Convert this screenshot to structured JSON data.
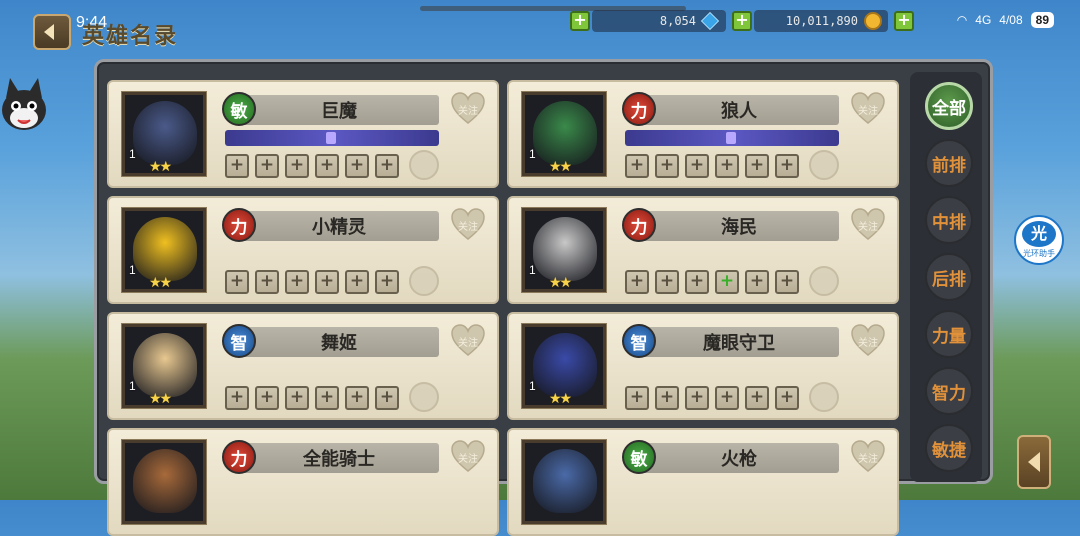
{
  "status_bar": {
    "time": "9:44",
    "signal": "4G",
    "battery": "89",
    "network_speed": "4/08"
  },
  "header": {
    "title": "英雄名录",
    "back_icon": "back-arrow-icon"
  },
  "resources": [
    {
      "name": "diamond",
      "value": "8,054",
      "icon": "gem-icon"
    },
    {
      "name": "gold",
      "value": "10,011,890",
      "icon": "coin-icon"
    }
  ],
  "filters": [
    {
      "label": "全部",
      "active": true
    },
    {
      "label": "前排",
      "active": false
    },
    {
      "label": "中排",
      "active": false
    },
    {
      "label": "后排",
      "active": false
    },
    {
      "label": "力量",
      "active": false
    },
    {
      "label": "智力",
      "active": false
    },
    {
      "label": "敏捷",
      "active": false
    }
  ],
  "heroes": [
    {
      "name": "巨魔",
      "class": "敏",
      "class_type": "agi",
      "level": "1",
      "stars": 2,
      "progress": true,
      "art_color": "#4a5a8a",
      "slots": [
        "+",
        "+",
        "+",
        "+",
        "+",
        "+"
      ],
      "ready_slot": -1,
      "follow": "关注"
    },
    {
      "name": "狼人",
      "class": "力",
      "class_type": "str",
      "level": "1",
      "stars": 2,
      "progress": true,
      "art_color": "#3a8a4a",
      "slots": [
        "+",
        "+",
        "+",
        "+",
        "+",
        "+"
      ],
      "ready_slot": -1,
      "follow": "关注"
    },
    {
      "name": "小精灵",
      "class": "力",
      "class_type": "str",
      "level": "1",
      "stars": 2,
      "progress": false,
      "art_color": "#f0c020",
      "slots": [
        "+",
        "+",
        "+",
        "+",
        "+",
        "+"
      ],
      "ready_slot": -1,
      "follow": "关注"
    },
    {
      "name": "海民",
      "class": "力",
      "class_type": "str",
      "level": "1",
      "stars": 2,
      "progress": false,
      "art_color": "#c8c8c8",
      "slots": [
        "+",
        "+",
        "+",
        "+",
        "+",
        "+"
      ],
      "ready_slot": 3,
      "follow": "关注"
    },
    {
      "name": "舞姬",
      "class": "智",
      "class_type": "int",
      "level": "1",
      "stars": 2,
      "progress": false,
      "art_color": "#e8c890",
      "slots": [
        "+",
        "+",
        "+",
        "+",
        "+",
        "+"
      ],
      "ready_slot": -1,
      "follow": "关注"
    },
    {
      "name": "魔眼守卫",
      "class": "智",
      "class_type": "int",
      "level": "1",
      "stars": 2,
      "progress": false,
      "art_color": "#3a4aa8",
      "slots": [
        "+",
        "+",
        "+",
        "+",
        "+",
        "+"
      ],
      "ready_slot": -1,
      "follow": "关注"
    },
    {
      "name": "全能骑士",
      "class": "力",
      "class_type": "str",
      "level": "",
      "stars": 0,
      "progress": false,
      "art_color": "#a86a3a",
      "slots": [],
      "ready_slot": -1,
      "follow": "关注"
    },
    {
      "name": "火枪",
      "class": "敏",
      "class_type": "agi",
      "level": "",
      "stars": 0,
      "progress": false,
      "art_color": "#4a6aa8",
      "slots": [],
      "ready_slot": -1,
      "follow": "关注"
    }
  ],
  "assist": {
    "mark": "光",
    "label": "光环助手"
  }
}
